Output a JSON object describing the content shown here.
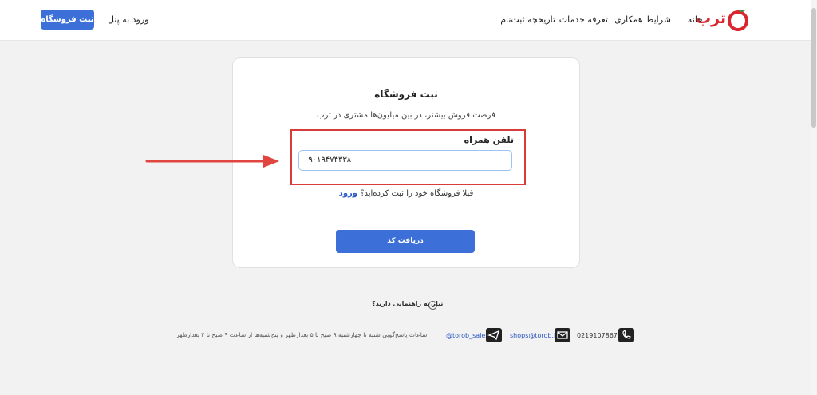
{
  "header": {
    "logo_text": "ترب",
    "nav": [
      "خانه",
      "شرایط همکاری",
      "تعرفه خدمات",
      "تاریخچه ثبت‌نام"
    ],
    "panel_login": "ورود به پنل",
    "register_button": "ثبت فروشگاه"
  },
  "card": {
    "title": "ثبت فروشگاه",
    "subtitle": "فرصت فروش بیشتر، در بین میلیون‌ها مشتری در ترب",
    "phone_label": "تلفن همراه",
    "phone_value": "۰۹۰۱۹۴۷۴۳۳۸",
    "already_text": "قبلا فروشگاه خود را ثبت کرده‌اید؟",
    "login_link": "ورود",
    "get_code_button": "دریافت کد"
  },
  "footer": {
    "help": "نیاز به راهنمایی دارید؟",
    "hours": "ساعات پاسخ‌گویی شنبه تا چهارشنبه ۹ صبح تا ۵ بعدازظهر و پنج‌شنبه‌ها از ساعت ۹ صبح تا ۲ بعدازظهر",
    "telegram": "@torob_sales",
    "email": "shops@torob.ir",
    "phone": "02191078676"
  },
  "colors": {
    "accent": "#3c6fd8",
    "brand_red": "#d8272f",
    "highlight_box": "#d93b3b"
  },
  "icons": [
    "torob-logo-icon",
    "telegram-icon",
    "email-icon",
    "phone-icon",
    "chevron-down-icon",
    "arrow-annotation"
  ]
}
